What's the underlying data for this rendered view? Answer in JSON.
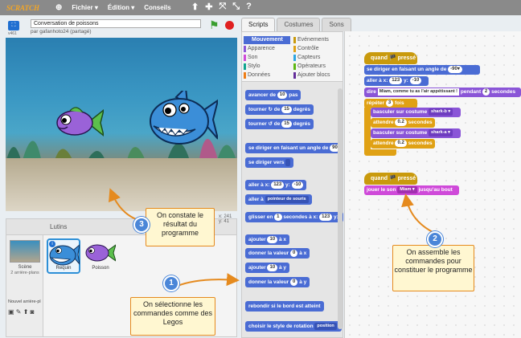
{
  "menubar": {
    "logo": "SCRATCH",
    "file": "Fichier ▾",
    "edit": "Édition ▾",
    "tips": "Conseils",
    "tools": [
      "⬆",
      "✚",
      "⤧",
      "⤡",
      "?"
    ]
  },
  "project": {
    "title": "Conversation de poissons",
    "author": "par gafanhoto24 (partagé)",
    "version": "v461"
  },
  "tabs": [
    "Scripts",
    "Costumes",
    "Sons"
  ],
  "categories": {
    "left": [
      "Mouvement",
      "Apparence",
      "Son",
      "Stylo",
      "Données"
    ],
    "right": [
      "Evénements",
      "Contrôle",
      "Capteurs",
      "Opérateurs",
      "Ajouter blocs"
    ]
  },
  "cat_colors": {
    "Mouvement": "#4a6cd4",
    "Apparence": "#8a55d7",
    "Son": "#cf4ad9",
    "Stylo": "#0fa58f",
    "Données": "#ee7d16",
    "Evénements": "#c99a0d",
    "Contrôle": "#e0a114",
    "Capteurs": "#2ca5e2",
    "Opérateurs": "#5cb712",
    "Ajouter blocs": "#632d99"
  },
  "palette_blocks": [
    {
      "pre": "avancer de",
      "n": "10",
      "post": "pas"
    },
    {
      "pre": "tourner ↻ de",
      "n": "15",
      "post": "degrés"
    },
    {
      "pre": "tourner ↺ de",
      "n": "15",
      "post": "degrés"
    },
    {
      "pre": "se diriger en faisant un angle de",
      "n": "90",
      "post": ""
    },
    {
      "pre": "se diriger vers",
      "d": " ",
      "post": ""
    },
    {
      "pre": "aller à x:",
      "n": "123",
      "post": "y:",
      "n2": "-10"
    },
    {
      "pre": "aller à",
      "d": "pointeur de souris",
      "post": ""
    },
    {
      "pre": "glisser en",
      "n": "1",
      "post": "secondes à x:",
      "n2": "123",
      "post2": "y:"
    },
    {
      "pre": "ajouter",
      "n": "10",
      "post": "à x"
    },
    {
      "pre": "donner la valeur",
      "n": "0",
      "post": "à x"
    },
    {
      "pre": "ajouter",
      "n": "10",
      "post": "à y"
    },
    {
      "pre": "donner la valeur",
      "n": "0",
      "post": "à y"
    },
    {
      "pre": "rebondir si le bord est atteint"
    },
    {
      "pre": "choisir le style de rotation",
      "d": "position",
      "post": ""
    }
  ],
  "sprites_panel": {
    "title": "Lutins",
    "scene_label": "Scène",
    "scene_sub": "2 arrière-plans",
    "new_bg": "Nouvel arrière-pl",
    "coords": "x: 241 y: 41",
    "sprites": [
      "Requin",
      "Poisson"
    ]
  },
  "script1": {
    "hat": "quand 🏴 pressé",
    "b1": {
      "pre": "se diriger en faisant un angle de",
      "n": "-90▾"
    },
    "b2": {
      "pre": "aller à x:",
      "n": "123",
      "mid": "y:",
      "n2": "-10"
    },
    "b3": {
      "pre": "dire",
      "t": "Miam, comme tu as l'air appétissant !",
      "mid": "pendant",
      "n": "2",
      "post": "secondes"
    },
    "repeat": {
      "pre": "répéter",
      "n": "3",
      "post": "fois"
    },
    "c1": {
      "pre": "basculer sur costume",
      "d": "shark-b ▾"
    },
    "w1": {
      "pre": "attendre",
      "n": "0.2",
      "post": "secondes"
    },
    "c2": {
      "pre": "basculer sur costume",
      "d": "shark-a ▾"
    },
    "w2": {
      "pre": "attendre",
      "n": "0.2",
      "post": "secondes"
    }
  },
  "script2": {
    "hat": "quand 🏴 pressé",
    "b1": {
      "pre": "jouer le son",
      "d": "Miam ▾",
      "post": "jusqu'au bout"
    }
  },
  "callouts": [
    {
      "n": "1",
      "text": "On sélectionne les commandes comme des Legos"
    },
    {
      "n": "2",
      "text": "On assemble les commandes pour constituer le programme"
    },
    {
      "n": "3",
      "text": "On constate le résultat du programme"
    }
  ]
}
